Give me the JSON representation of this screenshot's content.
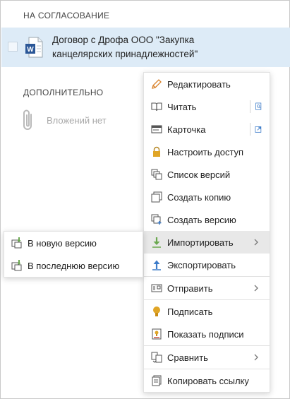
{
  "sections": {
    "approval_title": "НА СОГЛАСОВАНИЕ",
    "additional_title": "ДОПОЛНИТЕЛЬНО"
  },
  "document": {
    "title_line1": "Договор с Дрофа ООО \"Закупка",
    "title_line2": "канцелярских принадлежностей\"",
    "icon": "word-document-icon"
  },
  "attachments": {
    "empty_text": "Вложений нет",
    "icon": "paperclip-icon"
  },
  "context_menu": {
    "items": [
      {
        "label": "Редактировать",
        "icon": "pencil-icon"
      },
      {
        "label": "Читать",
        "icon": "book-icon",
        "extra_icon": "preview-icon"
      },
      {
        "label": "Карточка",
        "icon": "card-icon",
        "extra_icon": "open-external-icon"
      },
      {
        "label": "Настроить доступ",
        "icon": "lock-icon"
      },
      {
        "label": "Список версий",
        "icon": "versions-list-icon"
      },
      {
        "label": "Создать копию",
        "icon": "copy-icon"
      },
      {
        "label": "Создать версию",
        "icon": "new-version-icon"
      },
      {
        "label": "Импортировать",
        "icon": "import-arrow-icon",
        "has_submenu": true,
        "active": true
      },
      {
        "label": "Экспортировать",
        "icon": "export-arrow-icon"
      },
      {
        "label": "Отправить",
        "icon": "send-icon",
        "has_submenu": true
      },
      {
        "label": "Подписать",
        "icon": "seal-icon"
      },
      {
        "label": "Показать подписи",
        "icon": "signatures-icon"
      },
      {
        "label": "Сравнить",
        "icon": "compare-icon",
        "has_submenu": true
      },
      {
        "label": "Копировать ссылку",
        "icon": "copy-link-icon"
      }
    ]
  },
  "import_submenu": {
    "items": [
      {
        "label": "В новую версию",
        "icon": "import-new-version-icon"
      },
      {
        "label": "В последнюю версию",
        "icon": "import-last-version-icon"
      }
    ]
  },
  "colors": {
    "selected_row": "#ddebf7",
    "active_menu_item": "#e8e8e8",
    "import_green": "#6aa84f",
    "export_blue": "#3d7cc9",
    "seal_gold": "#e0a526"
  }
}
